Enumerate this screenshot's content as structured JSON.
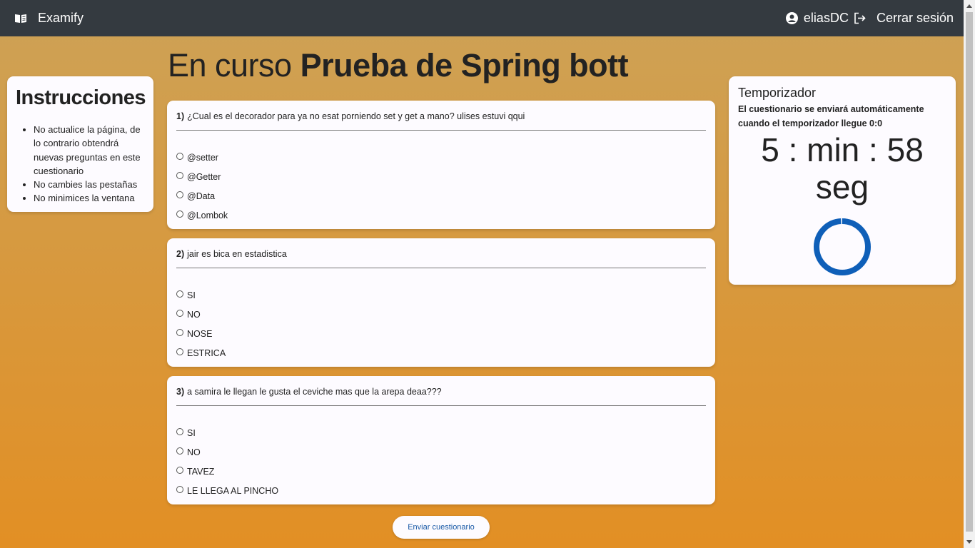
{
  "nav": {
    "brand": "Examify",
    "username": "eliasDC",
    "logout": "Cerrar sesión",
    "brand_icon": "open-book-icon",
    "user_icon": "user-circle-icon",
    "logout_icon": "logout-icon"
  },
  "instructions": {
    "title": "Instrucciones",
    "items": [
      "No actualice la página, de lo contrario obtendrá nuevas preguntas en este cuestionario",
      "No cambies las pestañas",
      "No minimices la ventana"
    ]
  },
  "exam": {
    "prefix": "En curso",
    "name": "Prueba de Spring bott"
  },
  "questions": [
    {
      "number": "1)",
      "text": "¿Cual es el decorador para ya no esat porniendo set y get a mano? ulises estuvi qqui",
      "options": [
        "@setter",
        "@Getter",
        "@Data",
        "@Lombok"
      ]
    },
    {
      "number": "2)",
      "text": "jair es bica en estadistica",
      "options": [
        "SI",
        "NO",
        "NOSE",
        "ESTRICA"
      ]
    },
    {
      "number": "3)",
      "text": "a samira le llegan le gusta el ceviche mas que la arepa deaa???",
      "options": [
        "SI",
        "NO",
        "TAVEZ",
        "LE LLEGA AL PINCHO"
      ]
    }
  ],
  "timer": {
    "title": "Temporizador",
    "description": "El cuestionario se enviará automáticamente cuando el temporizador llegue 0:0",
    "line1": "5 : min : 58",
    "line2": "seg",
    "progress_fraction": 0.99,
    "ring_color": "#0f5fb8"
  },
  "submit_label": "Enviar cuestionario"
}
